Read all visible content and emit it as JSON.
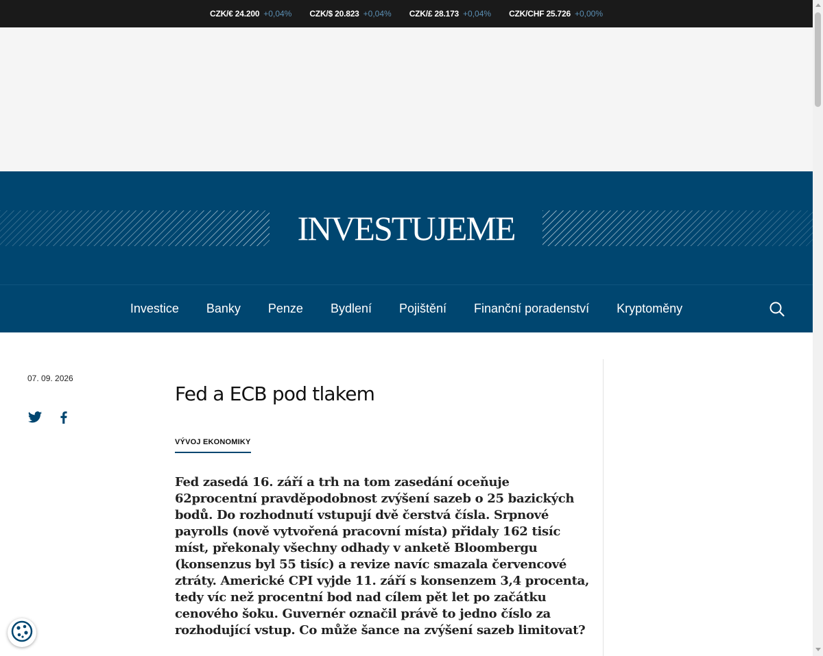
{
  "ticker": [
    {
      "pair": "CZK/€ 24.200",
      "change": "+0,04%"
    },
    {
      "pair": "CZK/$ 20.823",
      "change": "+0,04%"
    },
    {
      "pair": "CZK/£ 28.173",
      "change": "+0,04%"
    },
    {
      "pair": "CZK/CHF 25.726",
      "change": "+0,00%"
    }
  ],
  "brand": {
    "logo_text": "INVESTUJEME"
  },
  "nav": {
    "items": [
      "Investice",
      "Banky",
      "Penze",
      "Bydlení",
      "Pojištění",
      "Finanční poradenství",
      "Kryptoměny"
    ],
    "search_icon": "search-icon"
  },
  "article": {
    "date": "07. 09. 2026",
    "title": "Fed a ECB pod tlakem",
    "category": "VÝVOJ EKONOMIKY",
    "lead": "Fed zasedá 16. září a trh na tom zasedání oceňuje 62procentní pravděpodobnost zvýšení sazeb o 25 bazických bodů. Do rozhodnutí vstupují dvě čerstvá čísla. Srpnové payrolls (nově vytvořená pracovní místa) přidaly 162 tisíc míst, překonaly všechny odhady v anketě Bloombergu (konsenzus byl 55 tisíc) a revize navíc smazala červencové ztráty. Americké CPI vyjde 11. září s konsenzem 3,4 procenta, tedy víc než procentní bod nad cílem pět let po začátku cenového šoku. Guvernér označil právě to jedno číslo za rozhodující vstup. Co může šance na zvýšení sazeb limitovat?"
  },
  "share": {
    "icons": [
      "twitter-icon",
      "facebook-icon"
    ]
  },
  "colors": {
    "brand_blue": "#004670",
    "ticker_bg": "#1a1a1a",
    "ticker_change": "#5b8fb4",
    "ad_bg": "#f5f5f5"
  }
}
